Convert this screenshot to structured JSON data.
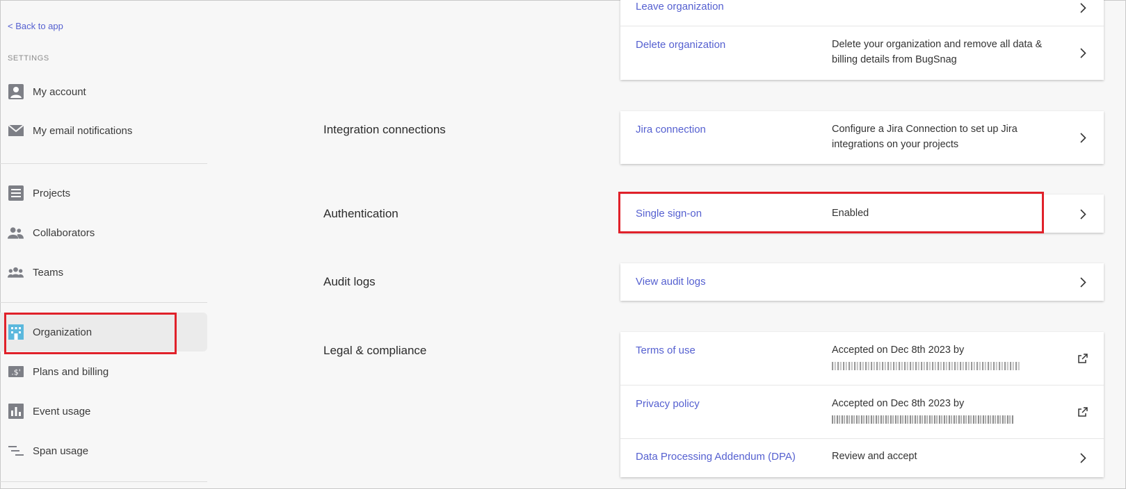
{
  "sidebar": {
    "back_label": "< Back to app",
    "settings_label": "SETTINGS",
    "group1": [
      {
        "label": "My account",
        "icon": "person-icon"
      },
      {
        "label": "My email notifications",
        "icon": "envelope-icon"
      }
    ],
    "group2": [
      {
        "label": "Projects",
        "icon": "projects-icon"
      },
      {
        "label": "Collaborators",
        "icon": "collaborators-icon"
      },
      {
        "label": "Teams",
        "icon": "teams-icon"
      }
    ],
    "group3": [
      {
        "label": "Organization",
        "icon": "building-icon"
      },
      {
        "label": "Plans and billing",
        "icon": "billing-icon"
      },
      {
        "label": "Event usage",
        "icon": "bar-chart-icon"
      },
      {
        "label": "Span usage",
        "icon": "span-icon"
      }
    ]
  },
  "sections": {
    "org_actions": {
      "leave_label": "Leave organization",
      "delete_label": "Delete organization",
      "delete_desc": "Delete your organization and remove all data & billing details from BugSnag"
    },
    "integration": {
      "title": "Integration connections",
      "jira_label": "Jira connection",
      "jira_desc": "Configure a Jira Connection to set up Jira integrations on your projects"
    },
    "authentication": {
      "title": "Authentication",
      "sso_label": "Single sign-on",
      "sso_status": "Enabled"
    },
    "audit": {
      "title": "Audit logs",
      "view_label": "View audit logs"
    },
    "legal": {
      "title": "Legal & compliance",
      "terms_label": "Terms of use",
      "terms_desc": "Accepted on Dec 8th 2023 by",
      "privacy_label": "Privacy policy",
      "privacy_desc": "Accepted on Dec 8th 2023 by",
      "dpa_label": "Data Processing Addendum (DPA)",
      "dpa_desc": "Review and accept"
    }
  },
  "colors": {
    "link": "#5560d0",
    "highlight": "#e0212a",
    "icon_gray": "#7d7f86",
    "org_icon": "#5bb8dd"
  }
}
